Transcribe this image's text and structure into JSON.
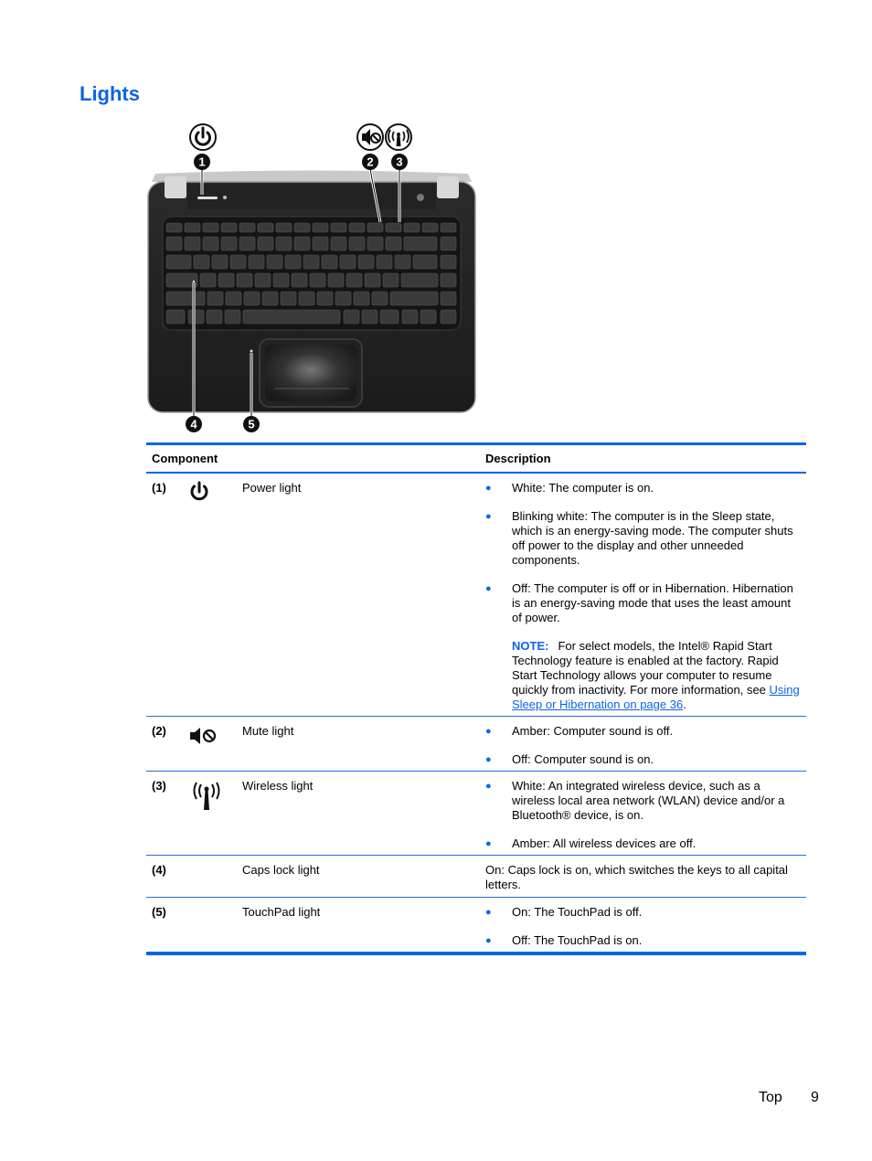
{
  "page": {
    "title": "Lights",
    "footer": {
      "section": "Top",
      "page_number": "9"
    }
  },
  "figure": {
    "callouts": [
      "1",
      "2",
      "3",
      "4",
      "5"
    ],
    "callout_icons": [
      "power-icon",
      "mute-icon",
      "wireless-icon"
    ]
  },
  "table": {
    "headers": {
      "component": "Component",
      "description": "Description"
    },
    "rows": [
      {
        "num": "(1)",
        "icon": "power-icon",
        "name": "Power light",
        "bullets": [
          "White: The computer is on.",
          "Blinking white: The computer is in the Sleep state, which is an energy-saving mode. The computer shuts off power to the display and other unneeded components.",
          "Off: The computer is off or in Hibernation. Hibernation is an energy-saving mode that uses the least amount of power."
        ],
        "note": {
          "label": "NOTE:",
          "text": "For select models, the Intel® Rapid Start Technology feature is enabled at the factory. Rapid Start Technology allows your computer to resume quickly from inactivity. For more information, see ",
          "link": "Using Sleep or Hibernation on page 36",
          "suffix": "."
        }
      },
      {
        "num": "(2)",
        "icon": "mute-icon",
        "name": "Mute light",
        "bullets": [
          "Amber: Computer sound is off.",
          "Off: Computer sound is on."
        ]
      },
      {
        "num": "(3)",
        "icon": "wireless-icon",
        "name": "Wireless light",
        "bullets": [
          "White: An integrated wireless device, such as a wireless local area network (WLAN) device and/or a Bluetooth® device, is on.",
          "Amber: All wireless devices are off."
        ]
      },
      {
        "num": "(4)",
        "icon": "",
        "name": "Caps lock light",
        "text": "On: Caps lock is on, which switches the keys to all capital letters."
      },
      {
        "num": "(5)",
        "icon": "",
        "name": "TouchPad light",
        "bullets": [
          "On: The TouchPad is off.",
          "Off: The TouchPad is on."
        ]
      }
    ],
    "bullet_glyph": "●"
  },
  "colors": {
    "accent": "#0b64e8",
    "rule": "#0066ee"
  }
}
